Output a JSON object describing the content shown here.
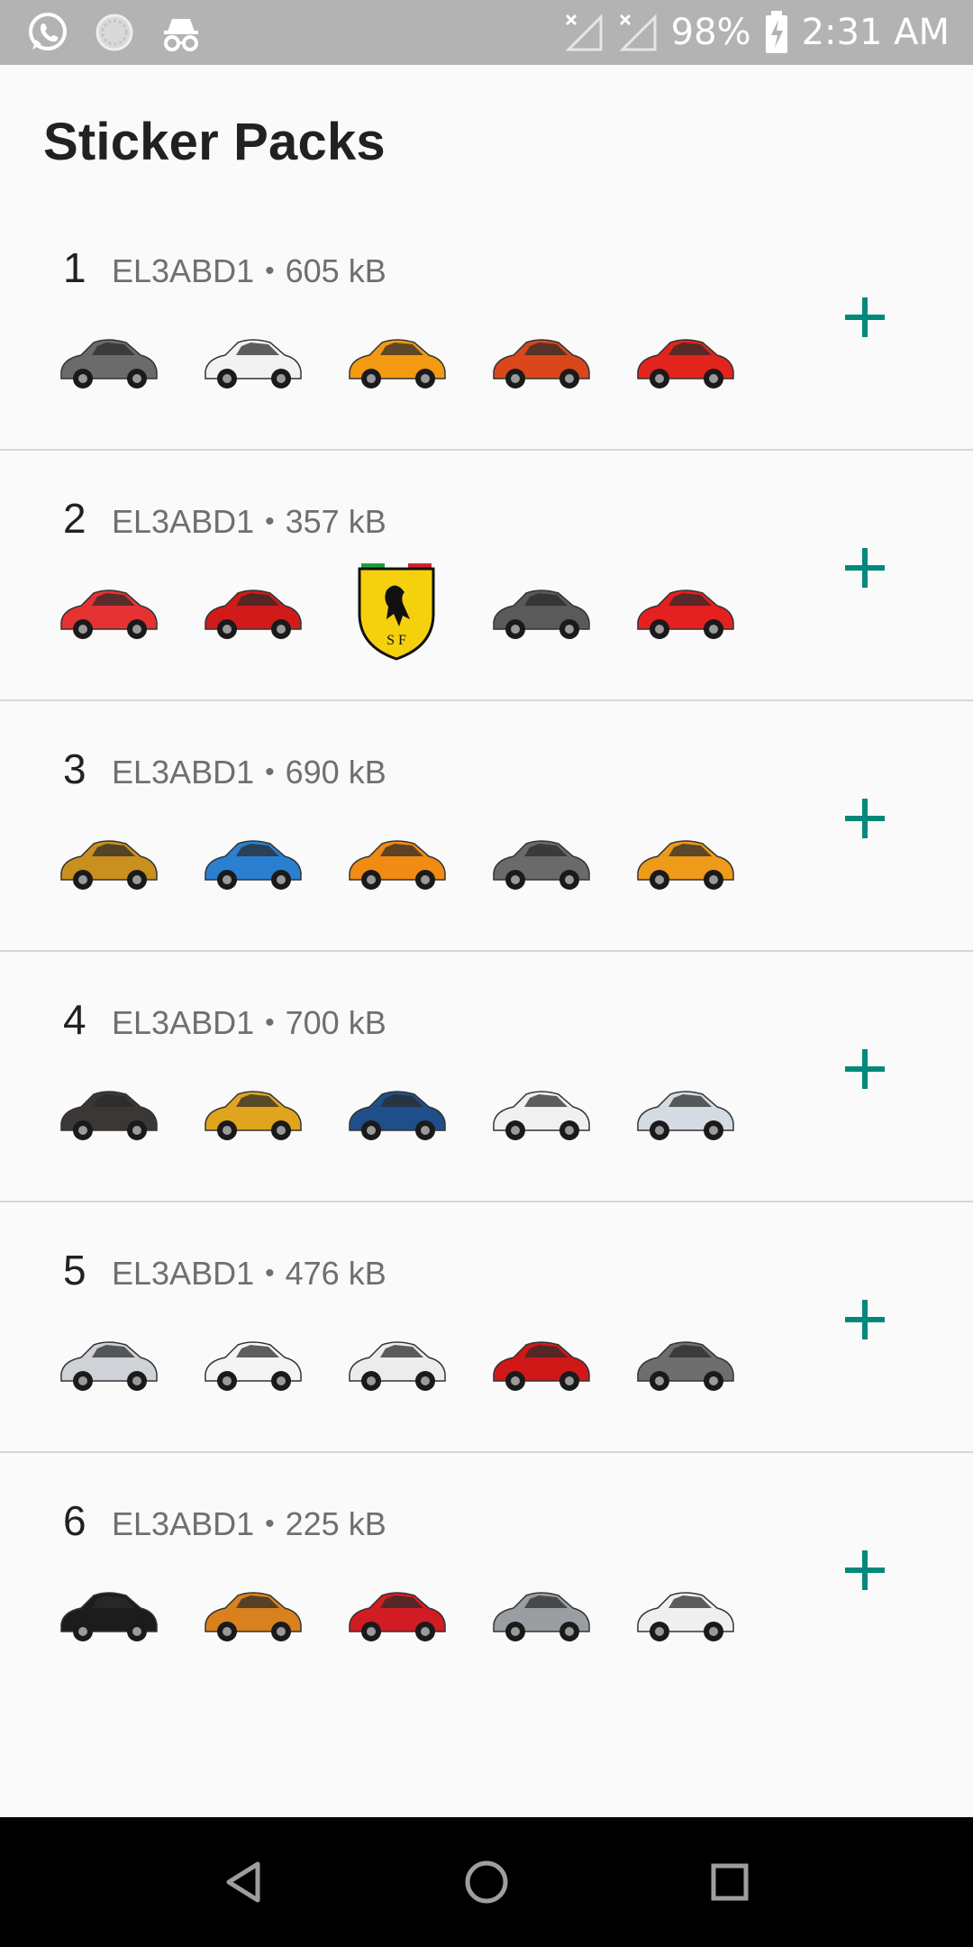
{
  "status_bar": {
    "battery": "98%",
    "time": "2:31 AM",
    "icons": [
      "whatsapp-icon",
      "loading-circle-icon",
      "incognito-icon",
      "no-signal-icon",
      "no-signal-icon",
      "battery-charging-icon"
    ]
  },
  "page": {
    "title": "Sticker Packs"
  },
  "colors": {
    "accent": "#00897b",
    "status_bar": "#b3b3b3",
    "nav_bar": "#000000"
  },
  "packs": [
    {
      "number": "1",
      "publisher": "EL3ABD1",
      "size": "605 kB",
      "stickers": [
        {
          "name": "gray-roadster-sticker",
          "color": "#6b6b6b"
        },
        {
          "name": "white-lamborghini-sticker",
          "color": "#f2f2f2"
        },
        {
          "name": "orange-huracan-sticker",
          "color": "#f39a12"
        },
        {
          "name": "orange-aventador-sticker",
          "color": "#d9471b"
        },
        {
          "name": "red-aventador-sticker",
          "color": "#e2241d"
        }
      ]
    },
    {
      "number": "2",
      "publisher": "EL3ABD1",
      "size": "357 kB",
      "stickers": [
        {
          "name": "red-ferrari-sticker",
          "color": "#e53333"
        },
        {
          "name": "red-enzo-sticker",
          "color": "#d11b1b"
        },
        {
          "name": "ferrari-logo-sticker",
          "color": "#f5d00c"
        },
        {
          "name": "gray-ferrari-sticker",
          "color": "#5a5a5a"
        },
        {
          "name": "red-f40-sticker",
          "color": "#e52020"
        }
      ]
    },
    {
      "number": "3",
      "publisher": "EL3ABD1",
      "size": "690 kB",
      "stickers": [
        {
          "name": "gold-renault-sticker",
          "color": "#c9901d"
        },
        {
          "name": "blue-mercedes-sticker",
          "color": "#2a7fd1"
        },
        {
          "name": "orange-lamborghini-sticker",
          "color": "#f28b13"
        },
        {
          "name": "gray-reventon-sticker",
          "color": "#6a6a6a"
        },
        {
          "name": "orange-gallardo-sticker",
          "color": "#ee9a1a"
        }
      ]
    },
    {
      "number": "4",
      "publisher": "EL3ABD1",
      "size": "700 kB",
      "stickers": [
        {
          "name": "dark-aston-martin-sticker",
          "color": "#3b3735"
        },
        {
          "name": "yellow-aston-martin-sticker",
          "color": "#e0a41d"
        },
        {
          "name": "blue-aston-martin-sticker",
          "color": "#1f4f8a"
        },
        {
          "name": "white-aston-martin-sticker",
          "color": "#f0f0f0"
        },
        {
          "name": "silver-aston-martin-sticker",
          "color": "#d4dbe3"
        }
      ]
    },
    {
      "number": "5",
      "publisher": "EL3ABD1",
      "size": "476 kB",
      "stickers": [
        {
          "name": "silver-audi-q3-sticker",
          "color": "#cfd2d6"
        },
        {
          "name": "white-audi-tt-sticker",
          "color": "#f4f4f4"
        },
        {
          "name": "white-audi-a1-sticker",
          "color": "#ececec"
        },
        {
          "name": "red-audi-tt-sticker",
          "color": "#d01818"
        },
        {
          "name": "gray-audi-r8-sticker",
          "color": "#6e6e6e"
        }
      ]
    },
    {
      "number": "6",
      "publisher": "EL3ABD1",
      "size": "225 kB",
      "stickers": [
        {
          "name": "black-audi-tt-sticker",
          "color": "#1c1c1c"
        },
        {
          "name": "orange-audi-q3-sticker",
          "color": "#d9811c"
        },
        {
          "name": "red-audi-a1-sticker",
          "color": "#d21c24"
        },
        {
          "name": "silver-audi-r8-sticker",
          "color": "#9a9ea3"
        },
        {
          "name": "white-audi-a1-sticker",
          "color": "#efefef"
        }
      ]
    }
  ],
  "nav": [
    "back-triangle-icon",
    "home-circle-icon",
    "recents-square-icon"
  ]
}
